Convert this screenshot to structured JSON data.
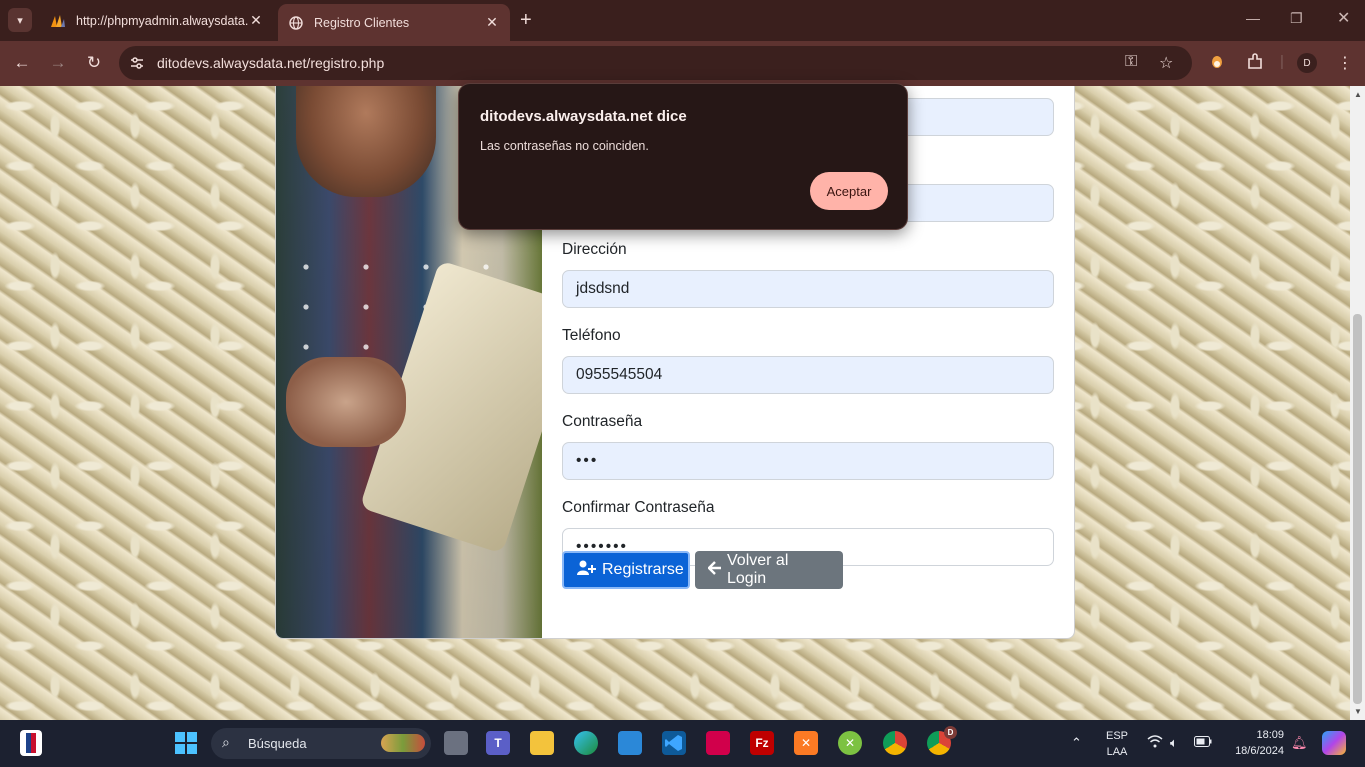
{
  "browser": {
    "tabs": [
      {
        "title": "http://phpmyadmin.alwaysdata.",
        "active": false
      },
      {
        "title": "Registro Clientes",
        "active": true
      }
    ],
    "new_tab": "+",
    "url": "ditodevs.alwaysdata.net/registro.php",
    "profile_initial": "D"
  },
  "form": {
    "direccion_label": "Dirección",
    "direccion_value": "jdsdsnd",
    "telefono_label": "Teléfono",
    "telefono_value": "0955545504",
    "password_label": "Contraseña",
    "password_value": "•••",
    "confirm_label": "Confirmar Contraseña",
    "confirm_value": "•••••••",
    "register_button": "Registrarse",
    "back_button": "Volver al Login"
  },
  "dialog": {
    "title": "ditodevs.alwaysdata.net dice",
    "message": "Las contraseñas no coinciden.",
    "ok_button": "Aceptar"
  },
  "taskbar": {
    "search_placeholder": "Búsqueda",
    "language": "ESP",
    "layout": "LAA",
    "time": "18:09",
    "date": "18/6/2024",
    "chrome_profile_badge": "D"
  },
  "colors": {
    "primary": "#0b63d6",
    "secondary": "#6c757d",
    "dialog_button": "#ffb3a9",
    "chrome_frame": "#3a1f1d"
  }
}
